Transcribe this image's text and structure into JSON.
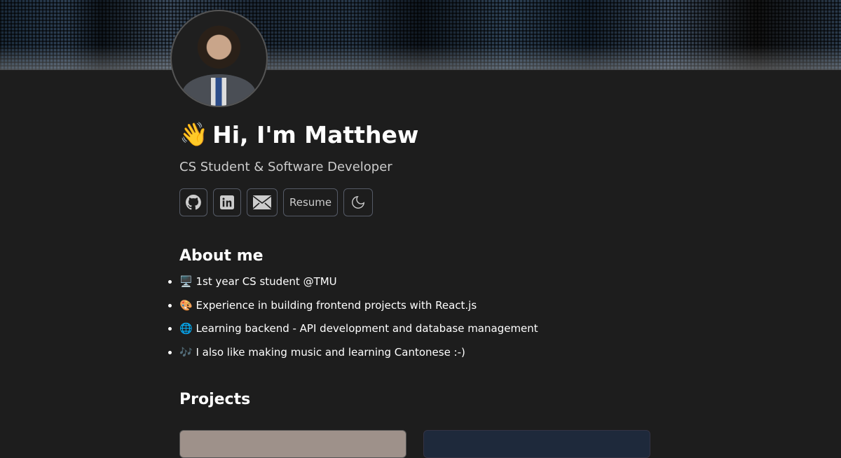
{
  "header": {
    "greeting_emoji": "👋",
    "title": "Hi, I'm Matthew",
    "subtitle": "CS Student & Software Developer"
  },
  "buttons": {
    "github": "github-icon",
    "linkedin": "linkedin-icon",
    "email": "mail-icon",
    "resume": "Resume",
    "theme": "moon-icon"
  },
  "about": {
    "heading": "About me",
    "items": [
      {
        "emoji": "🖥️",
        "text": "1st year CS student @TMU"
      },
      {
        "emoji": "🎨",
        "text": "Experience in building frontend projects with React.js"
      },
      {
        "emoji": "🌐",
        "text": "Learning backend - API development and database management"
      },
      {
        "emoji": "🎶",
        "text": "I also like making music and learning Cantonese :-)"
      }
    ]
  },
  "projects": {
    "heading": "Projects"
  }
}
